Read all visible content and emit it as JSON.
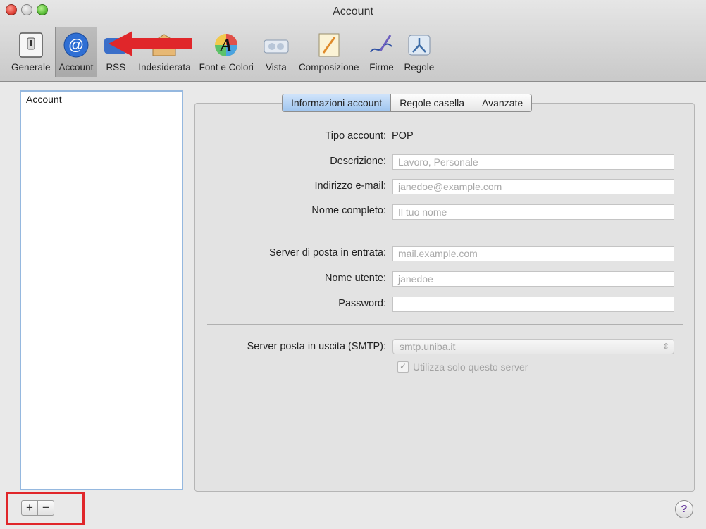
{
  "window": {
    "title": "Account"
  },
  "toolbar": {
    "items": [
      {
        "label": "Generale",
        "icon": "switch-icon"
      },
      {
        "label": "Account",
        "icon": "at-sign-icon",
        "selected": true
      },
      {
        "label": "RSS",
        "icon": "rss-icon"
      },
      {
        "label": "Indesiderata",
        "icon": "junk-mail-icon"
      },
      {
        "label": "Font e Colori",
        "icon": "fonts-colors-icon"
      },
      {
        "label": "Vista",
        "icon": "viewing-icon"
      },
      {
        "label": "Composizione",
        "icon": "composing-pencil-icon"
      },
      {
        "label": "Firme",
        "icon": "signature-pen-icon"
      },
      {
        "label": "Regole",
        "icon": "rules-icon"
      }
    ]
  },
  "sidebar": {
    "header": "Account",
    "add_label": "+",
    "remove_label": "−"
  },
  "tabs": [
    {
      "label": "Informazioni account",
      "active": true
    },
    {
      "label": "Regole casella"
    },
    {
      "label": "Avanzate"
    }
  ],
  "form": {
    "account_type_label": "Tipo account:",
    "account_type_value": "POP",
    "description_label": "Descrizione:",
    "description_placeholder": "Lavoro, Personale",
    "email_label": "Indirizzo e-mail:",
    "email_placeholder": "janedoe@example.com",
    "fullname_label": "Nome completo:",
    "fullname_placeholder": "Il tuo nome",
    "incoming_label": "Server di posta in entrata:",
    "incoming_placeholder": "mail.example.com",
    "username_label": "Nome utente:",
    "username_placeholder": "janedoe",
    "password_label": "Password:",
    "password_value": "",
    "smtp_label": "Server posta in uscita (SMTP):",
    "smtp_value": "smtp.uniba.it",
    "only_server_label": "Utilizza solo questo server",
    "only_server_checked": true
  },
  "help": {
    "label": "?"
  },
  "colors": {
    "accent": "#9fc5ef",
    "annotation": "#e0262a"
  }
}
